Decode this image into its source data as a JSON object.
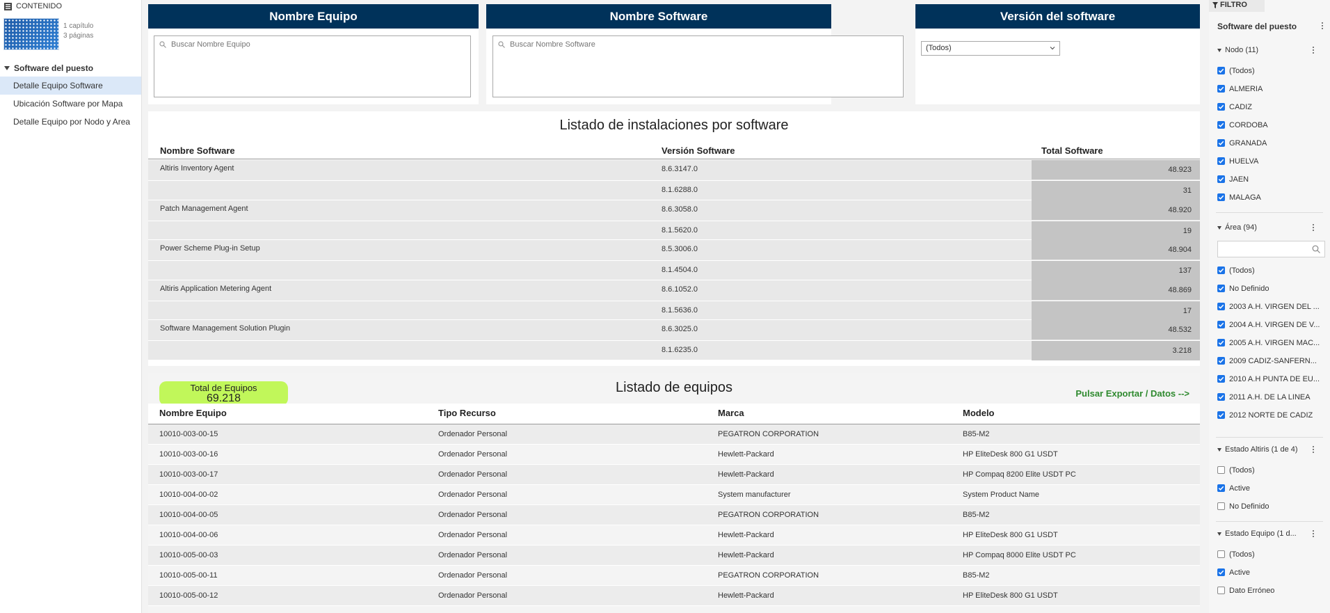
{
  "sidebar": {
    "header": "CONTENIDO",
    "meta_line1": "1 capítulo",
    "meta_line2": "3 páginas",
    "section": "Software del puesto",
    "items": [
      {
        "label": "Detalle Equipo Software"
      },
      {
        "label": "Ubicación Software por Mapa"
      },
      {
        "label": "Detalle Equipo por Nodo y Area"
      }
    ]
  },
  "controls": {
    "equipo_header": "Nombre Equipo",
    "equipo_placeholder": "Buscar Nombre Equipo",
    "software_header": "Nombre Software",
    "software_placeholder": "Buscar Nombre Software",
    "version_header": "Versión del software",
    "version_selected": "(Todos)"
  },
  "software_table": {
    "title": "Listado de instalaciones por software",
    "columns": [
      "Nombre Software",
      "Versión Software",
      "Total Software"
    ],
    "groups": [
      {
        "name": "Altiris Inventory Agent",
        "rows": [
          {
            "version": "8.6.3147.0",
            "total": "48.923"
          },
          {
            "version": "8.1.6288.0",
            "total": "31"
          }
        ]
      },
      {
        "name": "Patch Management Agent",
        "rows": [
          {
            "version": "8.6.3058.0",
            "total": "48.920"
          },
          {
            "version": "8.1.5620.0",
            "total": "19"
          }
        ]
      },
      {
        "name": "Power Scheme Plug-in Setup",
        "rows": [
          {
            "version": "8.5.3006.0",
            "total": "48.904"
          },
          {
            "version": "8.1.4504.0",
            "total": "137"
          }
        ]
      },
      {
        "name": "Altiris Application Metering Agent",
        "rows": [
          {
            "version": "8.6.1052.0",
            "total": "48.869"
          },
          {
            "version": "8.1.5636.0",
            "total": "17"
          }
        ]
      },
      {
        "name": "Software Management Solution Plugin",
        "rows": [
          {
            "version": "8.6.3025.0",
            "total": "48.532"
          },
          {
            "version": "8.1.6235.0",
            "total": "3.218"
          }
        ]
      }
    ]
  },
  "equipos_table": {
    "badge_label": "Total de Equipos",
    "badge_value": "69.218",
    "title": "Listado de equipos",
    "export_label": "Pulsar Exportar / Datos -->",
    "columns": [
      "Nombre Equipo",
      "Tipo Recurso",
      "Marca",
      "Modelo"
    ],
    "rows": [
      [
        "10010-003-00-15",
        "Ordenador Personal",
        "PEGATRON CORPORATION",
        "B85-M2"
      ],
      [
        "10010-003-00-16",
        "Ordenador Personal",
        "Hewlett-Packard",
        "HP EliteDesk 800 G1 USDT"
      ],
      [
        "10010-003-00-17",
        "Ordenador Personal",
        "Hewlett-Packard",
        "HP Compaq 8200 Elite USDT PC"
      ],
      [
        "10010-004-00-02",
        "Ordenador Personal",
        "System manufacturer",
        "System Product Name"
      ],
      [
        "10010-004-00-05",
        "Ordenador Personal",
        "PEGATRON CORPORATION",
        "B85-M2"
      ],
      [
        "10010-004-00-06",
        "Ordenador Personal",
        "Hewlett-Packard",
        "HP EliteDesk 800 G1 USDT"
      ],
      [
        "10010-005-00-03",
        "Ordenador Personal",
        "Hewlett-Packard",
        "HP Compaq 8000 Elite USDT PC"
      ],
      [
        "10010-005-00-11",
        "Ordenador Personal",
        "PEGATRON CORPORATION",
        "B85-M2"
      ],
      [
        "10010-005-00-12",
        "Ordenador Personal",
        "Hewlett-Packard",
        "HP EliteDesk 800 G1 USDT"
      ]
    ]
  },
  "filters": {
    "tab_label": "FILTRO",
    "title": "Software del puesto",
    "nodo": {
      "header": "Nodo (11)",
      "options": [
        {
          "label": "(Todos)",
          "checked": true
        },
        {
          "label": "ALMERIA",
          "checked": true
        },
        {
          "label": "CADIZ",
          "checked": true
        },
        {
          "label": "CORDOBA",
          "checked": true
        },
        {
          "label": "GRANADA",
          "checked": true
        },
        {
          "label": "HUELVA",
          "checked": true
        },
        {
          "label": "JAEN",
          "checked": true
        },
        {
          "label": "MALAGA",
          "checked": true
        }
      ]
    },
    "area": {
      "header": "Área (94)",
      "options": [
        {
          "label": "(Todos)",
          "checked": true
        },
        {
          "label": "No Definido",
          "checked": true
        },
        {
          "label": "2003 A.H. VIRGEN DEL ...",
          "checked": true
        },
        {
          "label": "2004 A.H. VIRGEN DE V...",
          "checked": true
        },
        {
          "label": "2005 A.H. VIRGEN MAC...",
          "checked": true
        },
        {
          "label": "2009 CADIZ-SANFERN...",
          "checked": true
        },
        {
          "label": "2010 A.H PUNTA DE EU...",
          "checked": true
        },
        {
          "label": "2011 A.H. DE LA LINEA",
          "checked": true
        },
        {
          "label": "2012 NORTE DE CADIZ",
          "checked": true
        }
      ]
    },
    "estado_altiris": {
      "header": "Estado Altiris (1 de 4)",
      "options": [
        {
          "label": "(Todos)",
          "checked": false
        },
        {
          "label": "Active",
          "checked": true
        },
        {
          "label": "No Definido",
          "checked": false
        }
      ]
    },
    "estado_equipo": {
      "header": "Estado Equipo (1 d...",
      "options": [
        {
          "label": "(Todos)",
          "checked": false
        },
        {
          "label": "Active",
          "checked": true
        },
        {
          "label": "Dato Erróneo",
          "checked": false
        }
      ]
    }
  },
  "colors": {
    "header_bg": "#00325a",
    "badge_bg": "#c1f75a",
    "export_link": "#2f8a2f",
    "checkbox_on": "#1a73e8"
  }
}
